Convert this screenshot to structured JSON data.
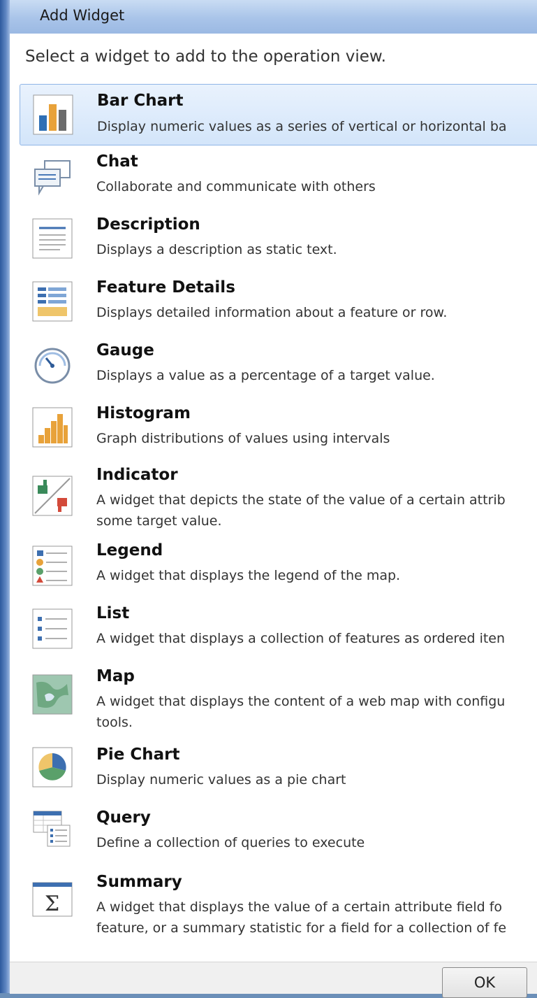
{
  "window": {
    "title": "Add Widget"
  },
  "dialog": {
    "prompt": "Select a widget to add to the operation view.",
    "selected_index": 0,
    "widgets": [
      {
        "title": "Bar Chart",
        "description": [
          "Display numeric values as a series of vertical or horizontal ba"
        ],
        "icon": "bar-chart-icon"
      },
      {
        "title": "Chat",
        "description": [
          "Collaborate and communicate with others"
        ],
        "icon": "chat-icon"
      },
      {
        "title": "Description",
        "description": [
          "Displays a description as static text."
        ],
        "icon": "description-icon"
      },
      {
        "title": "Feature Details",
        "description": [
          "Displays detailed information about a feature or row."
        ],
        "icon": "feature-details-icon"
      },
      {
        "title": "Gauge",
        "description": [
          "Displays a value as a percentage of a target value."
        ],
        "icon": "gauge-icon"
      },
      {
        "title": "Histogram",
        "description": [
          "Graph distributions of values using intervals"
        ],
        "icon": "histogram-icon"
      },
      {
        "title": "Indicator",
        "description": [
          "A widget that depicts the state of the value of a certain attrib",
          "some target value."
        ],
        "icon": "indicator-icon"
      },
      {
        "title": "Legend",
        "description": [
          "A widget that displays the legend of the map."
        ],
        "icon": "legend-icon"
      },
      {
        "title": "List",
        "description": [
          "A widget that displays a collection of features as ordered iten"
        ],
        "icon": "list-icon"
      },
      {
        "title": "Map",
        "description": [
          "A widget that displays the content of a web map with configu",
          "tools."
        ],
        "icon": "map-icon"
      },
      {
        "title": "Pie Chart",
        "description": [
          "Display numeric values as a pie chart"
        ],
        "icon": "pie-chart-icon"
      },
      {
        "title": "Query",
        "description": [
          "Define a collection of queries to execute"
        ],
        "icon": "query-icon"
      },
      {
        "title": "Summary",
        "description": [
          "A widget that displays the value of a certain attribute field fo",
          "feature, or a summary statistic for a field for a collection of fe"
        ],
        "icon": "summary-icon"
      }
    ]
  },
  "footer": {
    "ok_label": "OK"
  },
  "colors": {
    "accent": "#5a83c3",
    "selection": "#d3e5fa",
    "selection_border": "#8fb5e6"
  }
}
